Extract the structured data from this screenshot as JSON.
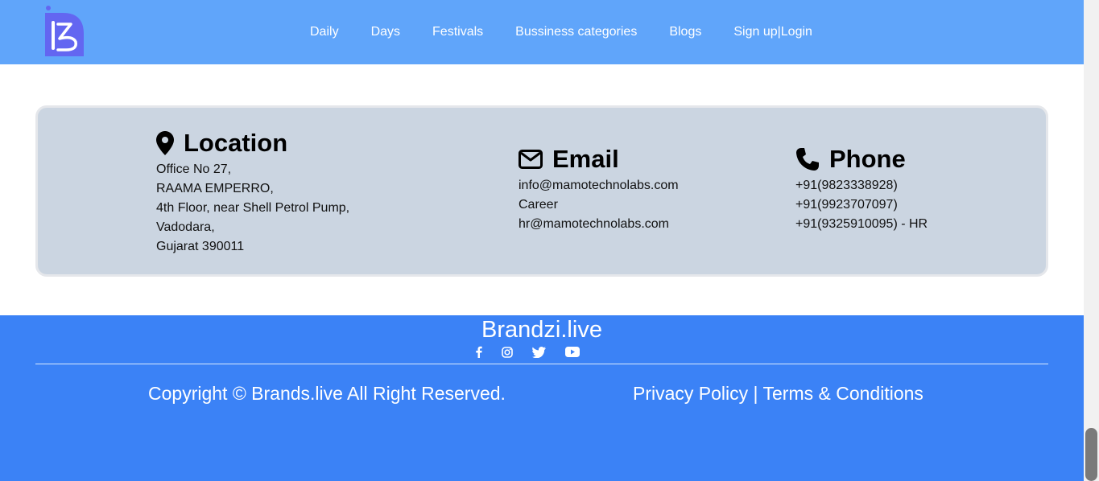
{
  "nav": {
    "links": [
      "Daily",
      "Days",
      "Festivals",
      "Bussiness categories",
      "Blogs",
      "Sign up|Login"
    ]
  },
  "contact": {
    "location": {
      "title": "Location",
      "icon": "map-pin-icon",
      "lines": [
        "Office No 27,",
        "RAAMA EMPERRO,",
        "4th Floor, near Shell Petrol Pump,",
        "Vadodara,",
        "Gujarat 390011"
      ]
    },
    "email": {
      "title": "Email",
      "icon": "envelope-icon",
      "lines": [
        "info@mamotechnolabs.com",
        "Career",
        "hr@mamotechnolabs.com"
      ]
    },
    "phone": {
      "title": "Phone",
      "icon": "phone-icon",
      "lines": [
        "+91(9823338928)",
        "+91(9923707097)",
        "+91(9325910095) - HR"
      ]
    }
  },
  "footer": {
    "brand": "Brandzi.live",
    "socials": [
      "facebook-icon",
      "instagram-icon",
      "twitter-icon",
      "youtube-icon"
    ],
    "copyright": "Copyright © Brands.live All Right Reserved.",
    "privacy": "Privacy Policy",
    "separator": " | ",
    "terms": "Terms & Conditions"
  },
  "colors": {
    "navbar": "#60a5fa",
    "footer": "#3b82f6",
    "card": "#cbd5e1",
    "logo": "#6366f1"
  }
}
